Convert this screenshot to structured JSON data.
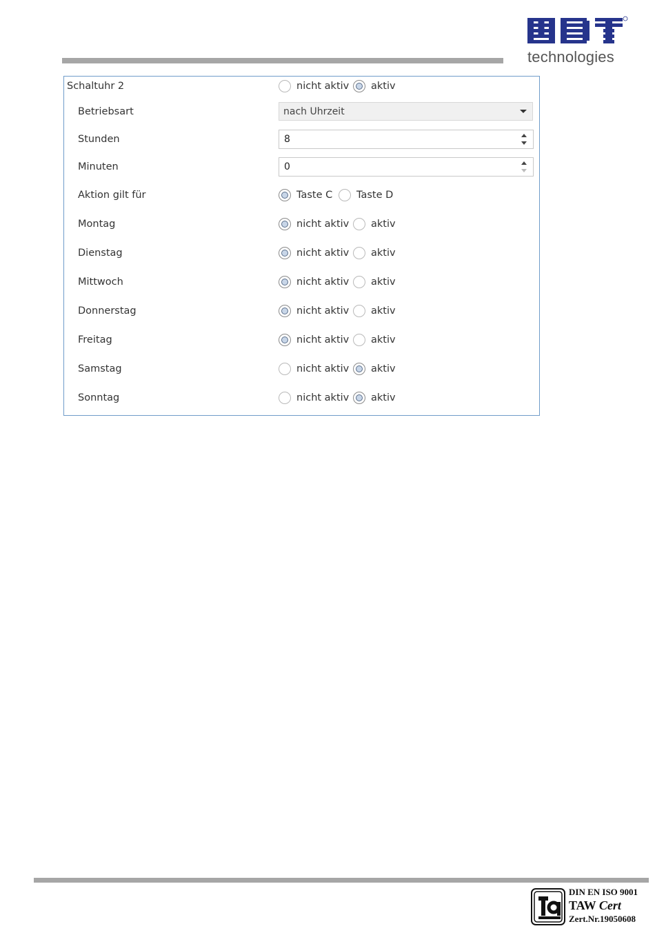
{
  "brand": {
    "logo_text": "technologies",
    "brand_color": "#26348c"
  },
  "panel": {
    "title": "Schaltuhr 2",
    "title_radio": {
      "options": [
        "nicht aktiv",
        "aktiv"
      ],
      "selected": "aktiv"
    },
    "betriebsart": {
      "label": "Betriebsart",
      "value": "nach Uhrzeit"
    },
    "stunden": {
      "label": "Stunden",
      "value": "8"
    },
    "minuten": {
      "label": "Minuten",
      "value": "0"
    },
    "aktion": {
      "label": "Aktion gilt für",
      "options": [
        "Taste C",
        "Taste D"
      ],
      "selected": "Taste C"
    },
    "days": [
      {
        "label": "Montag",
        "options": [
          "nicht aktiv",
          "aktiv"
        ],
        "selected": "nicht aktiv"
      },
      {
        "label": "Dienstag",
        "options": [
          "nicht aktiv",
          "aktiv"
        ],
        "selected": "nicht aktiv"
      },
      {
        "label": "Mittwoch",
        "options": [
          "nicht aktiv",
          "aktiv"
        ],
        "selected": "nicht aktiv"
      },
      {
        "label": "Donnerstag",
        "options": [
          "nicht aktiv",
          "aktiv"
        ],
        "selected": "nicht aktiv"
      },
      {
        "label": "Freitag",
        "options": [
          "nicht aktiv",
          "aktiv"
        ],
        "selected": "nicht aktiv"
      },
      {
        "label": "Samstag",
        "options": [
          "nicht aktiv",
          "aktiv"
        ],
        "selected": "aktiv"
      },
      {
        "label": "Sonntag",
        "options": [
          "nicht aktiv",
          "aktiv"
        ],
        "selected": "aktiv"
      }
    ]
  },
  "certificate": {
    "line1": "DIN EN ISO 9001",
    "line2_a": "TAW",
    "line2_b": "Cert",
    "line3": "Zert.Nr.19050608"
  }
}
